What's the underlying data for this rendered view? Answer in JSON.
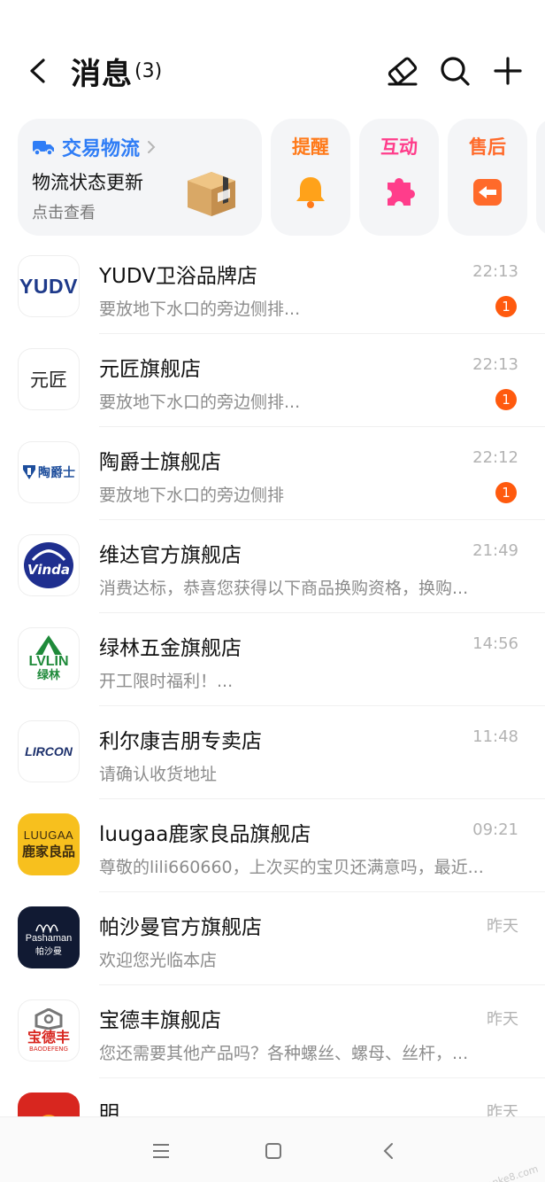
{
  "header": {
    "title": "消息",
    "count": "(3)",
    "icons": [
      "back-icon",
      "eraser-icon",
      "search-icon",
      "plus-icon"
    ]
  },
  "cards": {
    "logistics": {
      "title": "交易物流",
      "status": "物流状态更新",
      "hint": "点击查看",
      "accent": "#2f7df6"
    },
    "reminder": {
      "label": "提醒",
      "color": "#ff7a1a",
      "icon": "bell-icon"
    },
    "interact": {
      "label": "互动",
      "color": "#ff3d8b",
      "icon": "puzzle-icon"
    },
    "aftersale": {
      "label": "售后",
      "color": "#ff6a2a",
      "icon": "return-icon"
    }
  },
  "shops": [
    {
      "name": "YUDV卫浴品牌店",
      "time": "22:13",
      "preview": "要放地下水口的旁边侧排...",
      "badge": "1",
      "logo": "YUDV"
    },
    {
      "name": "元匠旗舰店",
      "time": "22:13",
      "preview": "要放地下水口的旁边侧排...",
      "badge": "1",
      "logo": "元匠"
    },
    {
      "name": "陶爵士旗舰店",
      "time": "22:12",
      "preview": "要放地下水口的旁边侧排",
      "badge": "1",
      "logo": "陶爵士"
    },
    {
      "name": "维达官方旗舰店",
      "time": "21:49",
      "preview": "消费达标，恭喜您获得以下商品换购资格，换购...",
      "badge": "",
      "logo": "Vinda"
    },
    {
      "name": "绿林五金旗舰店",
      "time": "14:56",
      "preview": "开工限时福利！...",
      "badge": "",
      "logo": "LVLIN",
      "logo2": "绿林"
    },
    {
      "name": "利尔康吉朋专卖店",
      "time": "11:48",
      "preview": "请确认收货地址",
      "badge": "",
      "logo": "LIRCON"
    },
    {
      "name": "luugaa鹿家良品旗舰店",
      "time": "09:21",
      "preview": "尊敬的lili660660，上次买的宝贝还满意吗，最近...",
      "badge": "",
      "logo": "LUUGAA",
      "logo2": "鹿家良品"
    },
    {
      "name": "帕沙曼官方旗舰店",
      "time": "昨天",
      "preview": "欢迎您光临本店",
      "badge": "",
      "logo": "Pashaman",
      "logo2": "帕沙曼"
    },
    {
      "name": "宝德丰旗舰店",
      "time": "昨天",
      "preview": "您还需要其他产品吗？各种螺丝、螺母、丝杆，...",
      "badge": "",
      "logo": "宝德丰",
      "logo2": "BAODEFENG"
    },
    {
      "name": "明",
      "time": "昨天",
      "preview": "",
      "badge": "",
      "logo": ""
    }
  ],
  "watermark": "赚客吧，有奖一起赚！ www.zuanke8.com"
}
